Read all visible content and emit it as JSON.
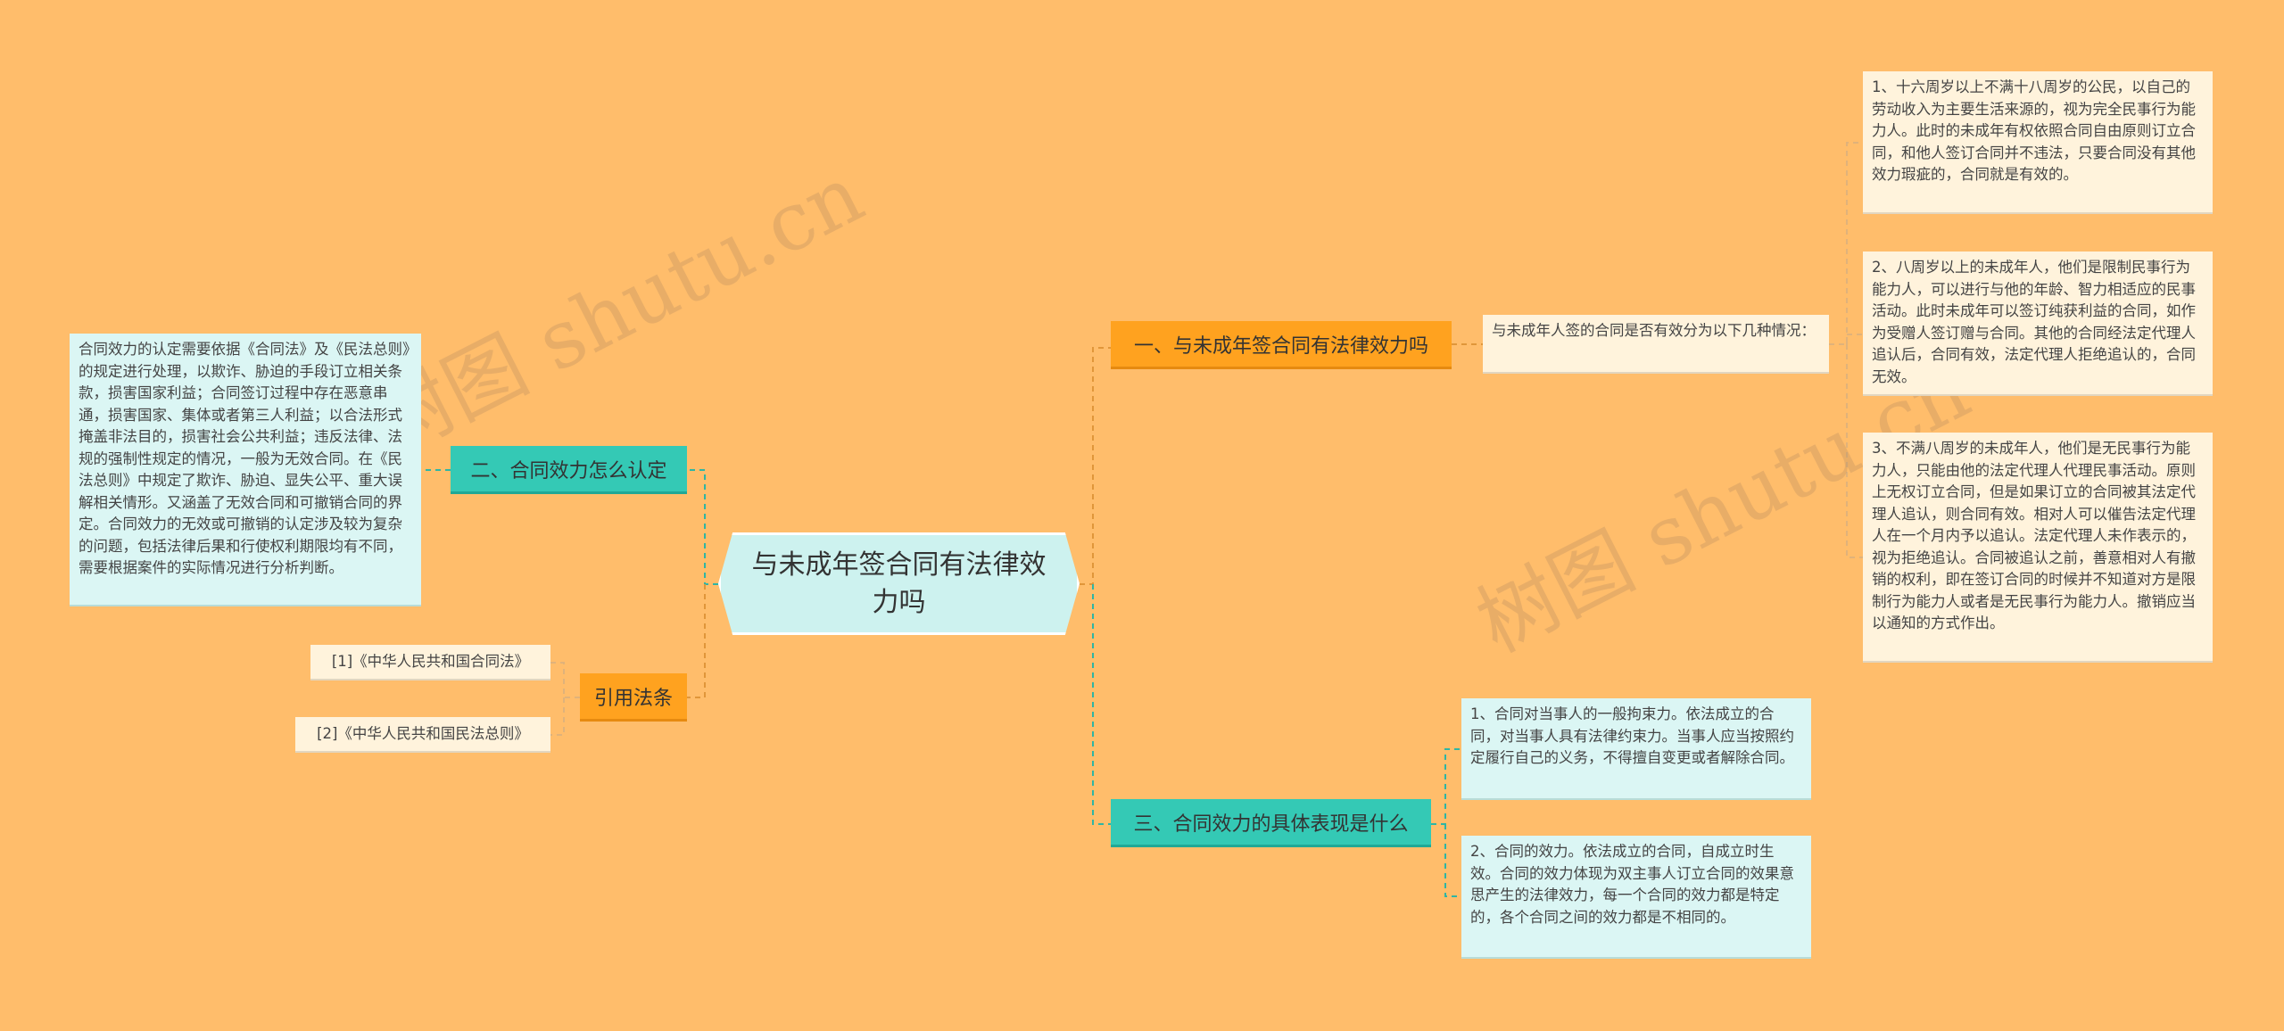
{
  "watermark": "树图 shutu.cn",
  "root": {
    "title": "与未成年签合同有法律效力吗"
  },
  "topics": {
    "t1": {
      "label": "一、与未成年签合同有法律效力吗",
      "intro": "与未成年人签的合同是否有效分为以下几种情况：",
      "items": [
        "1、十六周岁以上不满十八周岁的公民，以自己的劳动收入为主要生活来源的，视为完全民事行为能力人。此时的未成年有权依照合同自由原则订立合同，和他人签订合同并不违法，只要合同没有其他效力瑕疵的，合同就是有效的。",
        "2、八周岁以上的未成年人，他们是限制民事行为能力人，可以进行与他的年龄、智力相适应的民事活动。此时未成年可以签订纯获利益的合同，如作为受赠人签订赠与合同。其他的合同经法定代理人追认后，合同有效，法定代理人拒绝追认的，合同无效。",
        "3、不满八周岁的未成年人，他们是无民事行为能力人，只能由他的法定代理人代理民事活动。原则上无权订立合同，但是如果订立的合同被其法定代理人追认，则合同有效。相对人可以催告法定代理人在一个月内予以追认。法定代理人未作表示的，视为拒绝追认。合同被追认之前，善意相对人有撤销的权利，即在签订合同的时候并不知道对方是限制行为能力人或者是无民事行为能力人。撤销应当以通知的方式作出。"
      ]
    },
    "t2": {
      "label": "二、合同效力怎么认定",
      "detail": "合同效力的认定需要依据《合同法》及《民法总则》的规定进行处理，以欺诈、胁迫的手段订立相关条款，损害国家利益；合同签订过程中存在恶意串通，损害国家、集体或者第三人利益；以合法形式掩盖非法目的，损害社会公共利益；违反法律、法规的强制性规定的情况，一般为无效合同。在《民法总则》中规定了欺诈、胁迫、显失公平、重大误解相关情形。又涵盖了无效合同和可撤销合同的界定。合同效力的无效或可撤销的认定涉及较为复杂的问题，包括法律后果和行使权利期限均有不同，需要根据案件的实际情况进行分析判断。"
    },
    "t3": {
      "label": "三、合同效力的具体表现是什么",
      "items": [
        "1、合同对当事人的一般拘束力。依法成立的合同，对当事人具有法律约束力。当事人应当按照约定履行自己的义务，不得擅自变更或者解除合同。",
        "2、合同的效力。依法成立的合同，自成立时生效。合同的效力体现为双主事人订立合同的效果意思产生的法律效力，每一个合同的效力都是特定的，各个合同之间的效力都是不相同的。"
      ]
    },
    "t4": {
      "label": "引用法条",
      "items": [
        "[1]《中华人民共和国合同法》",
        "[2]《中华人民共和国民法总则》"
      ]
    }
  },
  "colors": {
    "background": "#ffbd6b",
    "orange_topic": "#ffa21f",
    "teal_topic": "#34c9b5",
    "root_fill": "#cdf2ef",
    "leaf_cream": "#fff3dc",
    "leaf_cyan": "#dbf6f4"
  }
}
